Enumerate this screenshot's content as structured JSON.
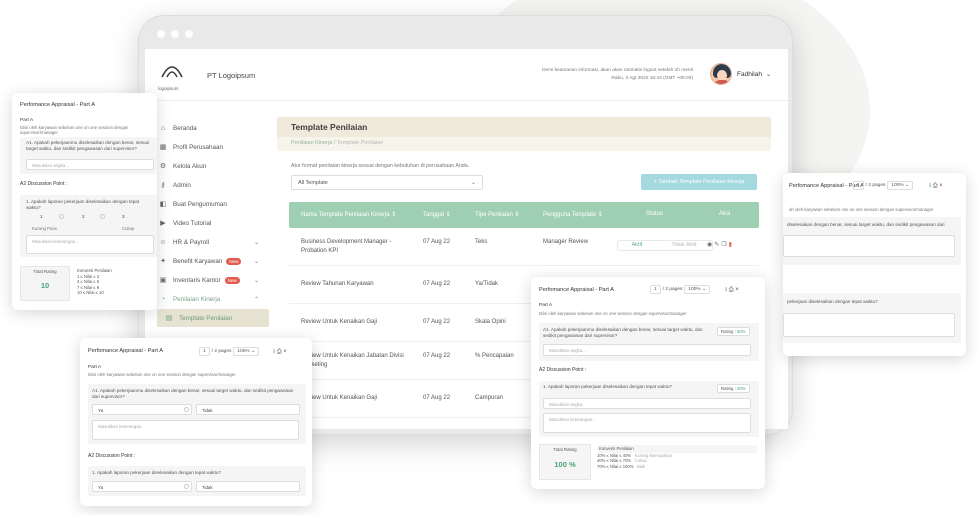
{
  "app": {
    "company": "PT Logoipsum",
    "logo_text": "logoipsum",
    "notice_line1": "Demi keamanan informasi, akan akan otomatis logout setelah 1h menit",
    "notice_line2": "Rabu, 3 Agt 2022 16:44 (GMT +06:00)",
    "user": "Fadhilah"
  },
  "sidebar": {
    "items": [
      {
        "label": "Beranda",
        "icon": "home-icon"
      },
      {
        "label": "Profil Perusahaan",
        "icon": "building-icon"
      },
      {
        "label": "Kelola Akun",
        "icon": "settings-icon"
      },
      {
        "label": "Admin",
        "icon": "key-icon"
      },
      {
        "label": "Buat Pengumuman",
        "icon": "megaphone-icon"
      },
      {
        "label": "Video Tutorial",
        "icon": "video-icon"
      },
      {
        "label": "HR & Payroll",
        "icon": "users-icon"
      },
      {
        "label": "Benefit Karyawan",
        "icon": "gift-icon",
        "badge": "New"
      },
      {
        "label": "Inventaris Kantor",
        "icon": "box-icon",
        "badge": "New"
      },
      {
        "label": "Penilaian Kinerja",
        "icon": "chart-icon"
      },
      {
        "label": "Template Penilaian",
        "icon": "template-icon"
      }
    ]
  },
  "page": {
    "title": "Template Penilaian",
    "breadcrumb_root": "Penilaian Kinerja",
    "breadcrumb_sep": "/",
    "breadcrumb_current": "Template Penilaian",
    "hint": "Atur format penilaian kinerja sesuai dengan kebutuhan di perusahaan Anda.",
    "filter_value": "All Template",
    "add_button": "+ Tambah Template Penilaian Kinerja"
  },
  "table": {
    "columns": [
      "Nama Template Penilaian Kinerja",
      "Tanggal",
      "Tipe Penilaian",
      "Pengguna Template",
      "Status",
      "Aksi"
    ],
    "rows": [
      {
        "name": "Business Development Manager - Probation KPI",
        "date": "07 Aug 22",
        "type": "Teks",
        "user": "Manager Review",
        "status_on": "Aktif",
        "status_off": "Tidak Aktif"
      },
      {
        "name": "Review Tahunan Karyawan",
        "date": "07 Aug 22",
        "type": "Ya/Tidak",
        "user": ""
      },
      {
        "name": "Review Untuk Kenaikan Gaji",
        "date": "07 Aug 22",
        "type": "Skala Opini",
        "user": ""
      },
      {
        "name": "Review Untuk Kenaikan Jabatan Divisi Marketing",
        "date": "07 Aug 22",
        "type": "% Pencapaian",
        "user": ""
      },
      {
        "name": "Review Untuk Kenaikan Gaji",
        "date": "07 Aug 22",
        "type": "Campuran",
        "user": ""
      }
    ]
  },
  "card_left": {
    "title": "Perfomance Appraisal - Part A",
    "part": "Part A",
    "desc": "Diisi oleh karyawan sebelum one on one session dengan supervisor/manager",
    "q1": "A1. Apakah pekerjaanmu diselesaikan dengan benar, sesuai target waktu, dan sedikit pengawasan dari supervisor?",
    "placeholder": "Masukkan angka...",
    "section2": "A2 Discussion Point :",
    "q2": "1. Apakah laporan pekerjaan diselesaikan dengan tepat waktu?",
    "scale": [
      "1",
      "2",
      "3"
    ],
    "scale_low": "Kurang Puas",
    "scale_high": "Cukup",
    "msg_placeholder": "Masukkan keterangan...",
    "total_label": "Total Rating",
    "total_value": "10",
    "conv_label": "Konversi Penilaian",
    "conv_rows": [
      "1   ≤   Nilai  ≤   3",
      "4   ≤   Nilai  ≤   6",
      "7   ≤   Nilai  ≤   9",
      "10  ≤   Nilai  ≤  10"
    ]
  },
  "card_bottom": {
    "title": "Perfomance Appraisal - Part A",
    "page_current": "1",
    "page_label": "/ 2 pages",
    "zoom": "100%",
    "part": "Part A",
    "desc": "Diisi oleh karyawan sebelum one on one session dengan supervisor/manager",
    "q1": "A1. Apakah pekerjaanmu diselesaikan dengan benar, sesuai target waktu, dan sedikit pengawasan dari supervisor?",
    "yes": "Ya",
    "no": "Tidak",
    "msg_placeholder": "Masukkan keterangan...",
    "section2": "A2 Discussion Point :",
    "q2": "1. Apakah laporan pekerjaan diselesaikan dengan tepat waktu?"
  },
  "card_center": {
    "title": "Perfomance Appraisal - Part A",
    "page_current": "1",
    "page_label": "/ 2 pages",
    "zoom": "100%",
    "part": "Part A",
    "desc": "Diisi oleh karyawan sebelum one on one session dengan supervisor/manager",
    "q1": "A1. Apakah pekerjaanmu diselesaikan dengan benar, sesuai target waktu, dan sedikit pengawasan dari supervisor?",
    "rating1_label": "Rating :",
    "rating1_value": "50%",
    "placeholder": "Masukkan angka...",
    "section2": "A2 Discussion Point :",
    "q2": "1. Apakah laporan pekerjaan diselesaikan dengan tepat waktu?",
    "rating2_label": "Rating :",
    "rating2_value": "20%",
    "msg_placeholder": "Masukkan keterangan...",
    "total_label": "Total Rating",
    "total_value": "100 %",
    "conv_label": "Konversi Penilaian",
    "conv_rows": [
      {
        "range": "10%    ≤    Nilai    ≤    40%",
        "note": "Kurang Memuaskan"
      },
      {
        "range": "40%    ≤    Nilai    ≤    70%",
        "note": "Cukup"
      },
      {
        "range": "70%    ≤    Nilai    ≤  100%",
        "note": "Baik"
      }
    ]
  },
  "card_right": {
    "title": "Perfomance Appraisal - Part A",
    "page_current": "1",
    "page_label": "/ 2 pages",
    "zoom": "100%",
    "desc": "ah oleh karyawan sebelum one on one session dengan supervisor/manager",
    "q1": "diselesaikan dengan benar, sesuai target waktu, dan sedikit pengawasan dari",
    "q2": "pekerjaan diselesaikan dengan tepat waktu?"
  }
}
